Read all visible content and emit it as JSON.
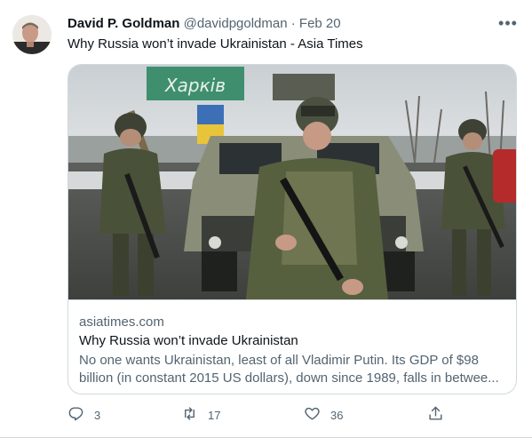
{
  "author": {
    "name": "David P. Goldman",
    "handle": "@davidpgoldman",
    "separator": "·",
    "date": "Feb 20"
  },
  "more_label": "•••",
  "tweet_text": "Why Russia won’t invade Ukrainistan - Asia Times",
  "card": {
    "image_sign_text": "Харків",
    "domain": "asiatimes.com",
    "title": "Why Russia won’t invade Ukrainistan",
    "description": "No one wants Ukrainistan, least of all Vladimir Putin. Its GDP of $98 billion (in constant 2015 US dollars), down since 1989, falls in betwee..."
  },
  "actions": {
    "reply_count": "3",
    "retweet_count": "17",
    "like_count": "36"
  },
  "icons": {
    "reply": "reply-icon",
    "retweet": "retweet-icon",
    "like": "heart-icon",
    "share": "share-icon",
    "more": "more-icon"
  },
  "colors": {
    "text_primary": "#0f1419",
    "text_secondary": "#536471",
    "border": "#cfd9de"
  }
}
